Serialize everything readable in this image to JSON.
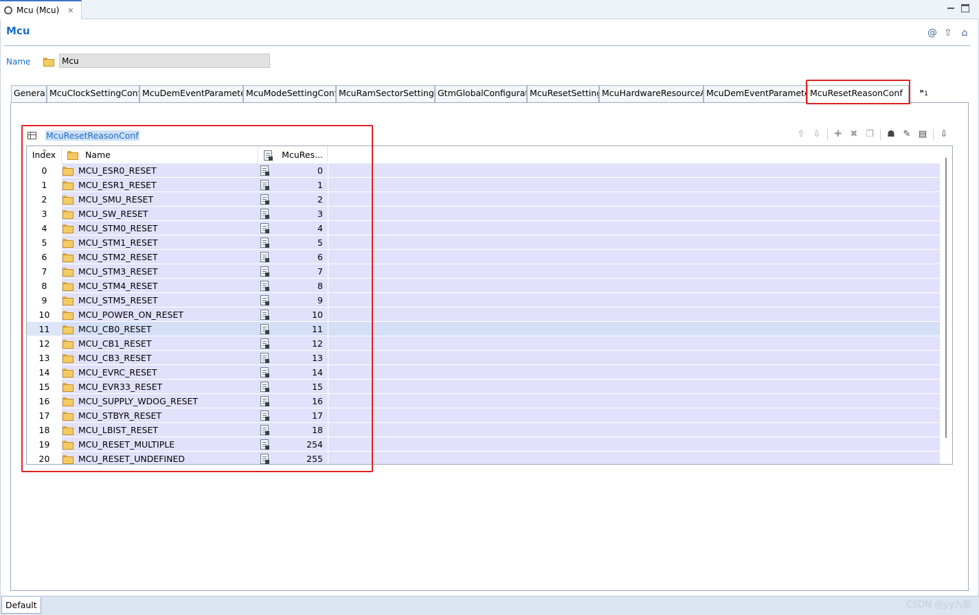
{
  "window": {
    "tab_title": "Mcu (Mcu)",
    "close_glyph": "✕"
  },
  "header": {
    "title": "Mcu",
    "icons": [
      "at-icon",
      "up-arrow-icon",
      "home-icon"
    ]
  },
  "name_field": {
    "label": "Name",
    "value": "Mcu"
  },
  "tabs": [
    "General",
    "McuClockSettingConfi",
    "McuDemEventParameter",
    "McuModeSettingConf",
    "McuRamSectorSettingC",
    "GtmGlobalConfigurati",
    "McuResetSetting",
    "McuHardwareResourceA",
    "McuDemEventParameter",
    "McuResetReasonConf"
  ],
  "active_tab": "McuResetReasonConf",
  "tabs_overflow": {
    "glyph": "»",
    "count": "1"
  },
  "table": {
    "title": "McuResetReasonConf",
    "columns": {
      "index": "Index",
      "name": "Name",
      "value": "McuRes..."
    },
    "selected_row": 11,
    "rows": [
      {
        "index": "0",
        "name": "MCU_ESR0_RESET",
        "value": "0"
      },
      {
        "index": "1",
        "name": "MCU_ESR1_RESET",
        "value": "1"
      },
      {
        "index": "2",
        "name": "MCU_SMU_RESET",
        "value": "2"
      },
      {
        "index": "3",
        "name": "MCU_SW_RESET",
        "value": "3"
      },
      {
        "index": "4",
        "name": "MCU_STM0_RESET",
        "value": "4"
      },
      {
        "index": "5",
        "name": "MCU_STM1_RESET",
        "value": "5"
      },
      {
        "index": "6",
        "name": "MCU_STM2_RESET",
        "value": "6"
      },
      {
        "index": "7",
        "name": "MCU_STM3_RESET",
        "value": "7"
      },
      {
        "index": "8",
        "name": "MCU_STM4_RESET",
        "value": "8"
      },
      {
        "index": "9",
        "name": "MCU_STM5_RESET",
        "value": "9"
      },
      {
        "index": "10",
        "name": "MCU_POWER_ON_RESET",
        "value": "10"
      },
      {
        "index": "11",
        "name": "MCU_CB0_RESET",
        "value": "11"
      },
      {
        "index": "12",
        "name": "MCU_CB1_RESET",
        "value": "12"
      },
      {
        "index": "13",
        "name": "MCU_CB3_RESET",
        "value": "13"
      },
      {
        "index": "14",
        "name": "MCU_EVRC_RESET",
        "value": "14"
      },
      {
        "index": "15",
        "name": "MCU_EVR33_RESET",
        "value": "15"
      },
      {
        "index": "16",
        "name": "MCU_SUPPLY_WDOG_RESET",
        "value": "16"
      },
      {
        "index": "17",
        "name": "MCU_STBYR_RESET",
        "value": "17"
      },
      {
        "index": "18",
        "name": "MCU_LBIST_RESET",
        "value": "18"
      },
      {
        "index": "19",
        "name": "MCU_RESET_MULTIPLE",
        "value": "254"
      },
      {
        "index": "20",
        "name": "MCU_RESET_UNDEFINED",
        "value": "255"
      }
    ]
  },
  "toolbar": {
    "move_up": "⇧",
    "move_down": "⇩",
    "add": "✚",
    "delete": "✖",
    "copy": "❐",
    "user": "☗",
    "edit": "✎",
    "form": "▤",
    "import": "⇩"
  },
  "bottom": {
    "tab": "Default",
    "watermark": "CSDN @yy九歌"
  },
  "colors": {
    "accent": "#1a6fc8",
    "row_bg": "#e1e1fb",
    "highlight": "#e02020"
  }
}
